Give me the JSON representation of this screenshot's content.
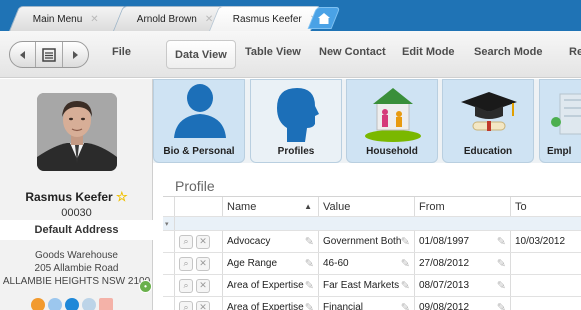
{
  "tabs": [
    {
      "label": "Main Menu"
    },
    {
      "label": "Arnold Brown"
    },
    {
      "label": "Rasmus Keefer"
    }
  ],
  "toolbar": {
    "file": "File",
    "data_view": "Data View",
    "table_view": "Table View",
    "new_contact": "New Contact",
    "edit_mode": "Edit Mode",
    "search_mode": "Search Mode",
    "more": "Re"
  },
  "contact": {
    "name": "Rasmus Keefer",
    "code": "00030",
    "address_header": "Default Address",
    "address_lines": [
      "Goods Warehouse",
      "205 Allambie Road",
      "ALLAMBIE HEIGHTS NSW 2100"
    ]
  },
  "categories": [
    {
      "label": "Bio & Personal"
    },
    {
      "label": "Profiles"
    },
    {
      "label": "Household"
    },
    {
      "label": "Education"
    },
    {
      "label": "Empl"
    }
  ],
  "profile": {
    "title": "Profile",
    "columns": [
      "Name",
      "Value",
      "From",
      "To"
    ],
    "rows": [
      {
        "name": "Advocacy",
        "value": "Government Both",
        "from": "01/08/1997",
        "to": "10/03/2012"
      },
      {
        "name": "Age Range",
        "value": "46-60",
        "from": "27/08/2012",
        "to": ""
      },
      {
        "name": "Area of Expertise",
        "value": "Far East Markets",
        "from": "08/07/2013",
        "to": ""
      },
      {
        "name": "Area of Expertise",
        "value": "Financial",
        "from": "09/08/2012",
        "to": ""
      }
    ]
  },
  "colors": {
    "tabstrip": "#1f73b5",
    "card": "#cfe3f3",
    "accent_green": "#6ab04c",
    "star": "#f0c000"
  }
}
